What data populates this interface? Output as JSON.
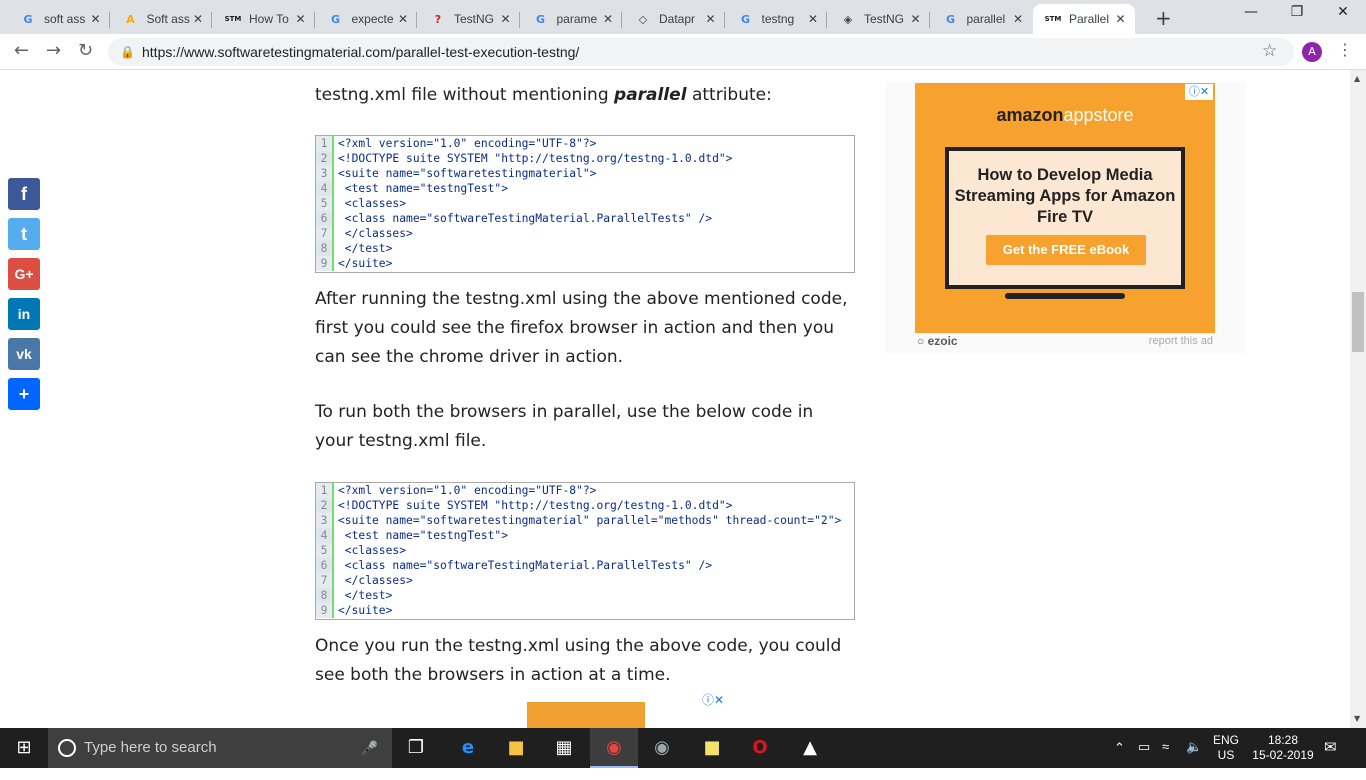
{
  "browser": {
    "tabs": [
      {
        "title": "soft ass",
        "favicon": "G",
        "favcolor": "#4285f4"
      },
      {
        "title": "Soft ass",
        "favicon": "A",
        "favcolor": "#f9ab00"
      },
      {
        "title": "How To",
        "favicon": "STM",
        "favcolor": "#1a1a1a"
      },
      {
        "title": "expecte",
        "favicon": "G",
        "favcolor": "#4285f4"
      },
      {
        "title": "TestNG",
        "favicon": "?",
        "favcolor": "#c62828"
      },
      {
        "title": "parame",
        "favicon": "G",
        "favcolor": "#4285f4"
      },
      {
        "title": "Datapr",
        "favicon": "◇",
        "favcolor": "#444"
      },
      {
        "title": "testng",
        "favicon": "G",
        "favcolor": "#4285f4"
      },
      {
        "title": "TestNG",
        "favicon": "◈",
        "favcolor": "#444"
      },
      {
        "title": "parallel",
        "favicon": "G",
        "favcolor": "#4285f4"
      },
      {
        "title": "Parallel",
        "favicon": "STM",
        "favcolor": "#1a1a1a"
      }
    ],
    "new_tab_icon": "+",
    "url": "https://www.softwaretestingmaterial.com/parallel-test-execution-testng/",
    "avatar_letter": "A"
  },
  "article": {
    "intro_text": "testng.xml file without mentioning ",
    "intro_bold": "parallel",
    "intro_after": " attribute:",
    "code1": [
      "<?xml version=\"1.0\" encoding=\"UTF-8\"?>",
      "<!DOCTYPE suite SYSTEM \"http://testng.org/testng-1.0.dtd\">",
      "<suite name=\"softwaretestingmaterial\">",
      " <test name=\"testngTest\">",
      " <classes>",
      " <class name=\"softwareTestingMaterial.ParallelTests\" />",
      " </classes>",
      " </test>",
      "</suite>"
    ],
    "para1": "After running the testng.xml using the above mentioned code, first you could see the firefox browser in action and then you can see the chrome driver in action.",
    "para2": "To run both the browsers in parallel, use the below code in your testng.xml file.",
    "code2": [
      "<?xml version=\"1.0\" encoding=\"UTF-8\"?>",
      "<!DOCTYPE suite SYSTEM \"http://testng.org/testng-1.0.dtd\">",
      "<suite name=\"softwaretestingmaterial\" parallel=\"methods\" thread-count=\"2\">",
      " <test name=\"testngTest\">",
      " <classes>",
      " <class name=\"softwareTestingMaterial.ParallelTests\" />",
      " </classes>",
      " </test>",
      "</suite>"
    ],
    "para3": "Once you run the testng.xml using the above code, you could see both the browsers in action at a time."
  },
  "social": [
    {
      "name": "facebook",
      "glyph": "f",
      "color": "#3b5998"
    },
    {
      "name": "twitter",
      "glyph": "t",
      "color": "#55acee"
    },
    {
      "name": "google-plus",
      "glyph": "G+",
      "color": "#dc4e41"
    },
    {
      "name": "linkedin",
      "glyph": "in",
      "color": "#0077b5"
    },
    {
      "name": "vk",
      "glyph": "vk",
      "color": "#4a76a8"
    },
    {
      "name": "share",
      "glyph": "+",
      "color": "#0166ff"
    }
  ],
  "ad": {
    "brand_bold": "amazon",
    "brand_rest": "appstore",
    "headline": "How to Develop Media Streaming Apps for Amazon Fire TV",
    "cta": "Get the FREE eBook",
    "badge": "ⓘ✕",
    "ezoic": "ezoic",
    "report": "report this ad"
  },
  "taskbar": {
    "search_placeholder": "Type here to search",
    "lang_top": "ENG",
    "lang_bottom": "US",
    "time": "18:28",
    "date": "15-02-2019"
  }
}
